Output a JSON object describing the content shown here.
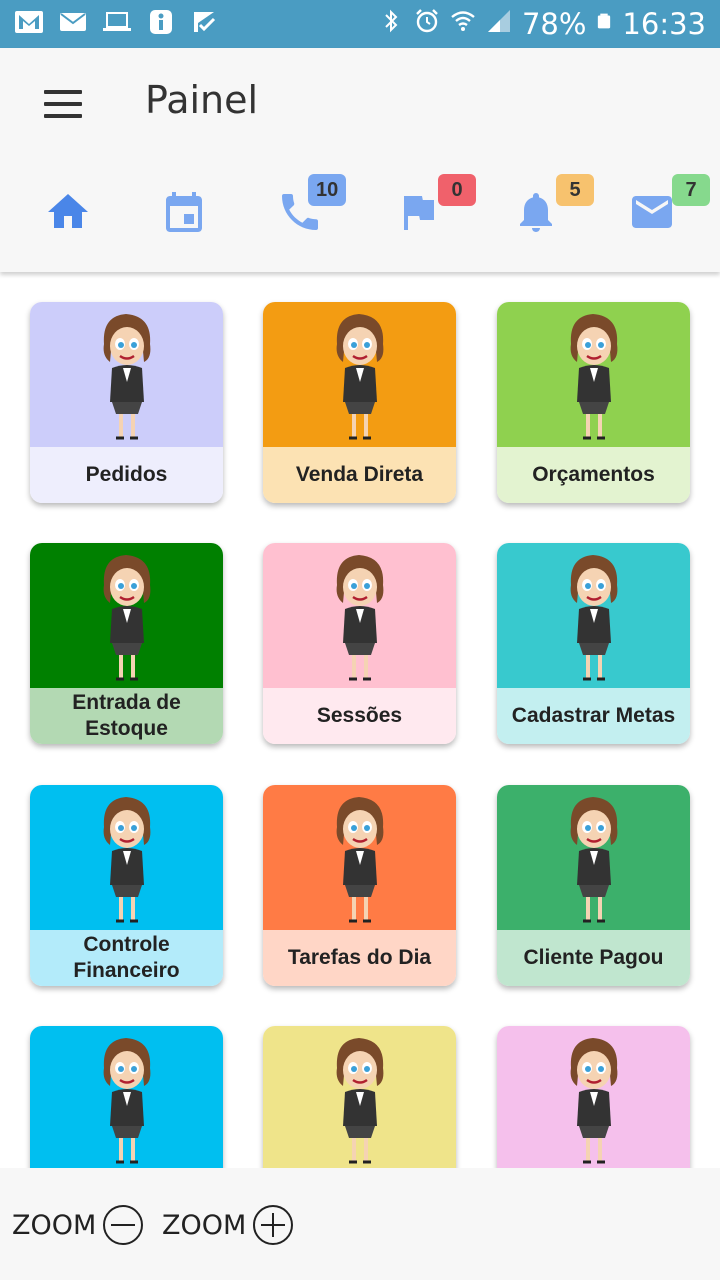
{
  "status": {
    "battery": "78%",
    "time": "16:33"
  },
  "header": {
    "title": "Painel"
  },
  "toolbar": {
    "phone_count": "10",
    "flag_count": "0",
    "bell_count": "5",
    "mail_count": "7"
  },
  "colors": {
    "accent": "#4a86e8",
    "status_bar": "#4a9cc2"
  },
  "tiles": [
    {
      "label": "Pedidos",
      "bg": "#cccdfa",
      "label_bg": "#eeeefd"
    },
    {
      "label": "Venda Direta",
      "bg": "#f39c12",
      "label_bg": "#fce2b3"
    },
    {
      "label": "Orçamentos",
      "bg": "#8fd14f",
      "label_bg": "#e3f3d0"
    },
    {
      "label": "Entrada de Estoque",
      "bg": "#008000",
      "label_bg": "#b3d9b3"
    },
    {
      "label": "Sessões",
      "bg": "#ffc0d0",
      "label_bg": "#ffe9ef"
    },
    {
      "label": "Cadastrar Metas",
      "bg": "#38c9ce",
      "label_bg": "#c3eff0"
    },
    {
      "label": "Controle Financeiro",
      "bg": "#00bff0",
      "label_bg": "#b3ebfa"
    },
    {
      "label": "Tarefas do Dia",
      "bg": "#ff7b45",
      "label_bg": "#ffd6c6"
    },
    {
      "label": "Cliente Pagou",
      "bg": "#3cb06b",
      "label_bg": "#c0e6cf"
    },
    {
      "label": "",
      "bg": "#00bff0",
      "label_bg": "#b3ebfa"
    },
    {
      "label": "",
      "bg": "#efe48a",
      "label_bg": "#faf6d8"
    },
    {
      "label": "",
      "bg": "#f5c0ec",
      "label_bg": "#fce8f8"
    }
  ],
  "zoom": {
    "out_label": "ZOOM",
    "in_label": "ZOOM"
  }
}
